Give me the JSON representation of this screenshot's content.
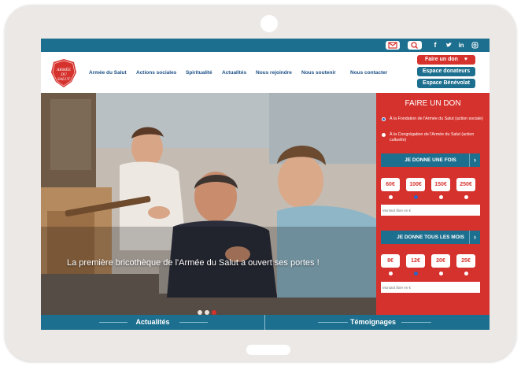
{
  "colors": {
    "brand_red": "#d6322d",
    "brand_blue": "#1c6f8e",
    "nav_text": "#1c4f86",
    "device_frame": "#ece8e5"
  },
  "utility_icons": [
    "mail-icon",
    "search-icon",
    "facebook-icon",
    "twitter-icon",
    "linkedin-icon",
    "instagram-icon"
  ],
  "logo": {
    "text_line1": "ARMÉE",
    "text_line2": "DU",
    "text_line3": "SALUT"
  },
  "nav": {
    "items": [
      {
        "label": "Armée du Salut"
      },
      {
        "label": "Actions sociales"
      },
      {
        "label": "Spiritualité"
      },
      {
        "label": "Actualités"
      },
      {
        "label": "Nous rejoindre"
      },
      {
        "label": "Nous soutenir"
      },
      {
        "label": "Nous contacter"
      }
    ]
  },
  "header_buttons": {
    "donate": "Faire un don",
    "donors": "Espace donateurs",
    "volunteers": "Espace Bénévolat"
  },
  "hero": {
    "caption": "La première bricothèque de l'Armée du Salut a ouvert ses portes !",
    "slide_count": 3,
    "active_slide": 3
  },
  "donation": {
    "title": "FAIRE UN DON",
    "options": [
      {
        "label": "À la Fondation de l'Armée du Salut (action sociale)",
        "selected": true
      },
      {
        "label": "À la Congrégation de l'Armée du Salut (action cultuelle)",
        "selected": false
      }
    ],
    "once": {
      "button": "JE DONNE UNE FOIS",
      "amounts": [
        "60€",
        "100€",
        "150€",
        "250€"
      ],
      "selected_index": 1,
      "free_placeholder": "Montant libre en €"
    },
    "monthly": {
      "button": "JE DONNE TOUS LES MOIS",
      "amounts": [
        "8€",
        "12€",
        "20€",
        "25€"
      ],
      "selected_index": 1,
      "free_placeholder": "Montant libre en €"
    },
    "chevron": "›"
  },
  "tabs": [
    {
      "label": "Actualités"
    },
    {
      "label": "Témoignages"
    }
  ]
}
